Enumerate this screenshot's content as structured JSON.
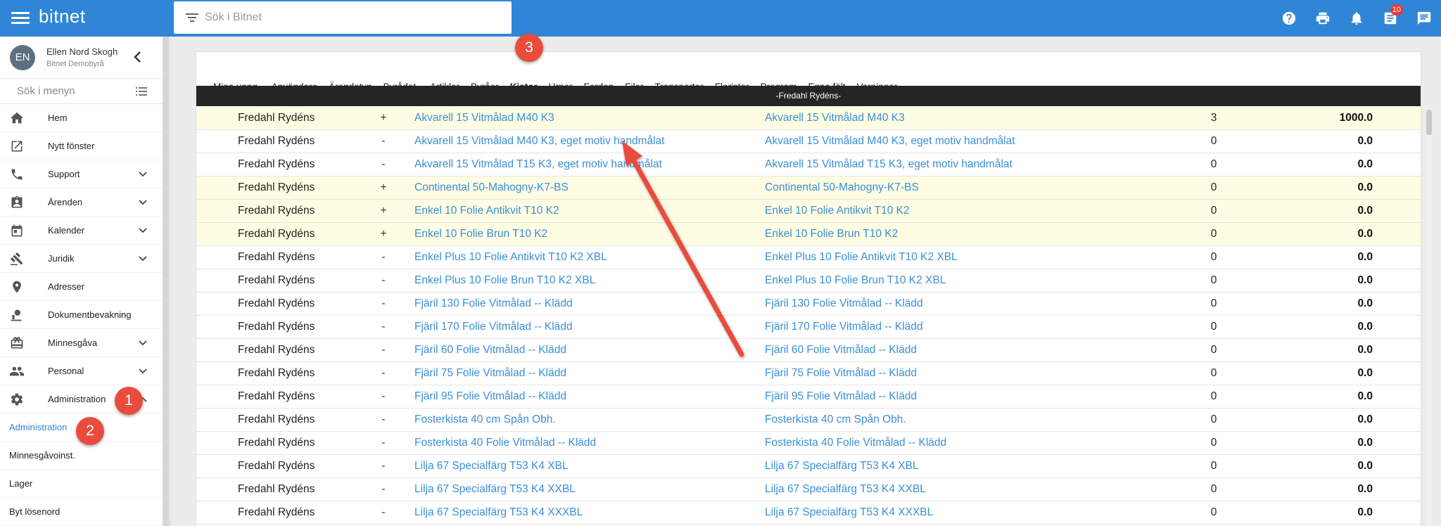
{
  "topbar": {
    "brand": "bitnet",
    "search_placeholder": "Sök i Bitnet",
    "icons": [
      "help-icon",
      "print-icon",
      "bell-icon",
      "tasks-icon",
      "chat-icon"
    ],
    "tasks_badge": "10",
    "color": "#2f86d6"
  },
  "user": {
    "initials": "EN",
    "name": "Ellen Nord Skogh",
    "org": "Bitnet Demobyrå"
  },
  "menu_search_placeholder": "Sök i menyn",
  "nav": [
    {
      "label": "Hem",
      "icon": "home-icon"
    },
    {
      "label": "Nytt fönster",
      "icon": "open-in-new-icon"
    },
    {
      "label": "Support",
      "icon": "phone-icon"
    },
    {
      "label": "Ärenden",
      "icon": "clipboard-icon"
    },
    {
      "label": "Kalender",
      "icon": "calendar-icon"
    },
    {
      "label": "Juridik",
      "icon": "gavel-icon"
    },
    {
      "label": "Adresser",
      "icon": "location-icon"
    },
    {
      "label": "Dokumentbevakning",
      "icon": "document-watch-icon"
    },
    {
      "label": "Minnesgåva",
      "icon": "gift-icon"
    },
    {
      "label": "Personal",
      "icon": "people-icon"
    },
    {
      "label": "Administration",
      "icon": "gear-icon"
    }
  ],
  "subnav": [
    {
      "label": "Administration",
      "active": true
    },
    {
      "label": "Minnesgåvoinst.",
      "active": false
    },
    {
      "label": "Lager",
      "active": false
    },
    {
      "label": "Byt lösenord",
      "active": false
    }
  ],
  "callouts": [
    "1",
    "2",
    "3"
  ],
  "tabs": [
    "Mina uppg.",
    "Användare",
    "Ärendetyp",
    "Byrådet.",
    "Artiklar",
    "Byråer",
    "Kistor",
    "Urnor",
    "Fordon",
    "Filer",
    "Transporter",
    "Florister",
    "Program",
    "Egna fält",
    "Varningar"
  ],
  "active_tab": "Kistor",
  "group_header": "-Fredahl Rydéns-",
  "rows": [
    {
      "name": "Fredahl Rydéns",
      "sign": "+",
      "product": "Akvarell 15 Vitmålad M40 K3",
      "product2": "Akvarell 15 Vitmålad M40 K3",
      "qty": "3",
      "value": "1000.0",
      "hl": true
    },
    {
      "name": "Fredahl Rydéns",
      "sign": "-",
      "product": "Akvarell 15 Vitmålad M40 K3, eget motiv handmålat",
      "product2": "Akvarell 15 Vitmålad M40 K3, eget motiv handmålat",
      "qty": "0",
      "value": "0.0",
      "hl": false
    },
    {
      "name": "Fredahl Rydéns",
      "sign": "-",
      "product": "Akvarell 15 Vitmålad T15 K3, eget motiv handmålat",
      "product2": "Akvarell 15 Vitmålad T15 K3, eget motiv handmålat",
      "qty": "0",
      "value": "0.0",
      "hl": false
    },
    {
      "name": "Fredahl Rydéns",
      "sign": "+",
      "product": "Continental 50-Mahogny-K7-BS",
      "product2": "Continental 50-Mahogny-K7-BS",
      "qty": "0",
      "value": "0.0",
      "hl": true
    },
    {
      "name": "Fredahl Rydéns",
      "sign": "+",
      "product": "Enkel 10 Folie Antikvit T10 K2",
      "product2": "Enkel 10 Folie Antikvit T10 K2",
      "qty": "0",
      "value": "0.0",
      "hl": true
    },
    {
      "name": "Fredahl Rydéns",
      "sign": "+",
      "product": "Enkel 10 Folie Brun T10 K2",
      "product2": "Enkel 10 Folie Brun T10 K2",
      "qty": "0",
      "value": "0.0",
      "hl": true
    },
    {
      "name": "Fredahl Rydéns",
      "sign": "-",
      "product": "Enkel Plus 10 Folie Antikvit T10 K2 XBL",
      "product2": "Enkel Plus 10 Folie Antikvit T10 K2 XBL",
      "qty": "0",
      "value": "0.0",
      "hl": false
    },
    {
      "name": "Fredahl Rydéns",
      "sign": "-",
      "product": "Enkel Plus 10 Folie Brun T10 K2 XBL",
      "product2": "Enkel Plus 10 Folie Brun T10 K2 XBL",
      "qty": "0",
      "value": "0.0",
      "hl": false
    },
    {
      "name": "Fredahl Rydéns",
      "sign": "-",
      "product": "Fjäril 130 Folie Vitmålad -- Klädd",
      "product2": "Fjäril 130 Folie Vitmålad -- Klädd",
      "qty": "0",
      "value": "0.0",
      "hl": false
    },
    {
      "name": "Fredahl Rydéns",
      "sign": "-",
      "product": "Fjäril 170 Folie Vitmålad -- Klädd",
      "product2": "Fjäril 170 Folie Vitmålad -- Klädd",
      "qty": "0",
      "value": "0.0",
      "hl": false
    },
    {
      "name": "Fredahl Rydéns",
      "sign": "-",
      "product": "Fjäril 60 Folie Vitmålad -- Klädd",
      "product2": "Fjäril 60 Folie Vitmålad -- Klädd",
      "qty": "0",
      "value": "0.0",
      "hl": false
    },
    {
      "name": "Fredahl Rydéns",
      "sign": "-",
      "product": "Fjäril 75 Folie Vitmålad -- Klädd",
      "product2": "Fjäril 75 Folie Vitmålad -- Klädd",
      "qty": "0",
      "value": "0.0",
      "hl": false
    },
    {
      "name": "Fredahl Rydéns",
      "sign": "-",
      "product": "Fjäril 95 Folie Vitmålad -- Klädd",
      "product2": "Fjäril 95 Folie Vitmålad -- Klädd",
      "qty": "0",
      "value": "0.0",
      "hl": false
    },
    {
      "name": "Fredahl Rydéns",
      "sign": "-",
      "product": "Fosterkista 40 cm Spån Obh.",
      "product2": "Fosterkista 40 cm Spån Obh.",
      "qty": "0",
      "value": "0.0",
      "hl": false
    },
    {
      "name": "Fredahl Rydéns",
      "sign": "-",
      "product": "Fosterkista 40 Folie Vitmålad -- Klädd",
      "product2": "Fosterkista 40 Folie Vitmålad -- Klädd",
      "qty": "0",
      "value": "0.0",
      "hl": false
    },
    {
      "name": "Fredahl Rydéns",
      "sign": "-",
      "product": "Lilja 67 Specialfärg T53 K4 XBL",
      "product2": "Lilja 67 Specialfärg T53 K4 XBL",
      "qty": "0",
      "value": "0.0",
      "hl": false
    },
    {
      "name": "Fredahl Rydéns",
      "sign": "-",
      "product": "Lilja 67 Specialfärg T53 K4 XXBL",
      "product2": "Lilja 67 Specialfärg T53 K4 XXBL",
      "qty": "0",
      "value": "0.0",
      "hl": false
    },
    {
      "name": "Fredahl Rydéns",
      "sign": "-",
      "product": "Lilja 67 Specialfärg T53 K4 XXXBL",
      "product2": "Lilja 67 Specialfärg T53 K4 XXXBL",
      "qty": "0",
      "value": "0.0",
      "hl": false
    }
  ]
}
